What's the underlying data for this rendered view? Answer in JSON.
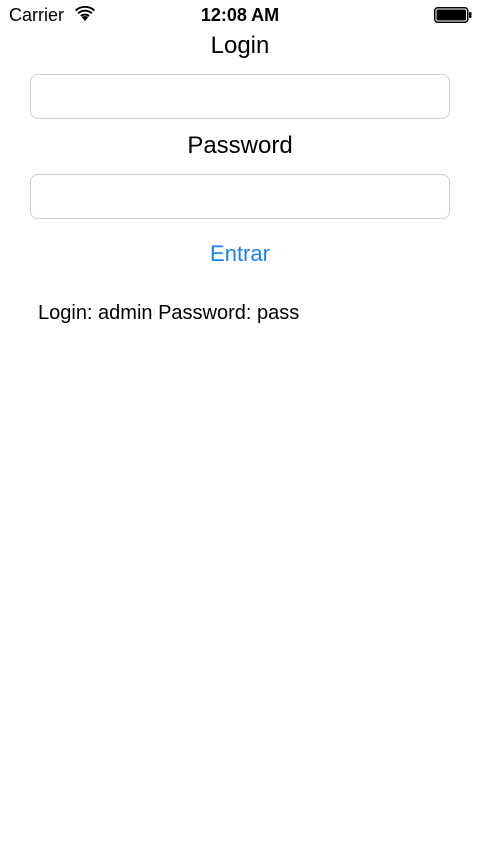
{
  "status_bar": {
    "carrier": "Carrier",
    "time": "12:08 AM",
    "wifi_icon": "wifi-icon",
    "battery_icon": "battery-full-icon"
  },
  "form": {
    "login_label": "Login",
    "login_value": "",
    "password_label": "Password",
    "password_value": "",
    "submit_label": "Entrar",
    "accent_color": "#1a82f7"
  },
  "hint": {
    "text": "Login: admin Password: pass"
  }
}
